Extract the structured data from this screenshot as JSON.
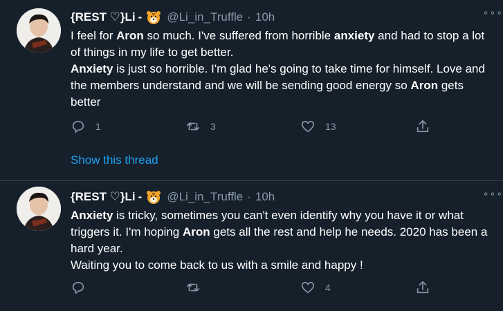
{
  "tweets": [
    {
      "name": "{REST ♡}Li",
      "dash": "-",
      "handle": "@Li_in_Truffle",
      "dot": "·",
      "time": "10h",
      "more": "∘∘∘",
      "paragraphs": [
        [
          {
            "t": "I feel for ",
            "b": false
          },
          {
            "t": "Aron",
            "b": true
          },
          {
            "t": " so much. I've suffered from horrible ",
            "b": false
          },
          {
            "t": "anxiety",
            "b": true
          },
          {
            "t": " and had to stop a lot of things in my life to get better.",
            "b": false
          }
        ],
        [
          {
            "t": "Anxiety",
            "b": true
          },
          {
            "t": " is just so horrible. I'm glad he's going to take time for himself. Love and the members understand and we will be sending good energy so ",
            "b": false
          },
          {
            "t": "Aron",
            "b": true
          },
          {
            "t": " gets better",
            "b": false
          }
        ]
      ],
      "reply_count": "1",
      "retweet_count": "3",
      "like_count": "13",
      "share_count": "",
      "show_thread": "Show this thread"
    },
    {
      "name": "{REST ♡}Li",
      "dash": "-",
      "handle": "@Li_in_Truffle",
      "dot": "·",
      "time": "10h",
      "more": "∘∘∘",
      "paragraphs": [
        [
          {
            "t": "Anxiety",
            "b": true
          },
          {
            "t": " is tricky, sometimes you can't even identify why you have it or what triggers it. I'm hoping ",
            "b": false
          },
          {
            "t": "Aron",
            "b": true
          },
          {
            "t": " gets all the rest and help he needs. 2020 has been a hard year.",
            "b": false
          }
        ],
        [
          {
            "t": "Waiting you to come back to us with a smile and happy !",
            "b": false
          }
        ]
      ],
      "reply_count": "",
      "retweet_count": "",
      "like_count": "4",
      "share_count": ""
    }
  ],
  "icons": {
    "reply": "reply-icon",
    "retweet": "retweet-icon",
    "like": "heart-icon",
    "share": "share-icon",
    "emoji": "tiger-face-emoji"
  },
  "colors": {
    "background": "#15202b",
    "text": "#ffffff",
    "muted": "#8899a6",
    "link": "#1da1f2",
    "divider": "#38444d"
  }
}
